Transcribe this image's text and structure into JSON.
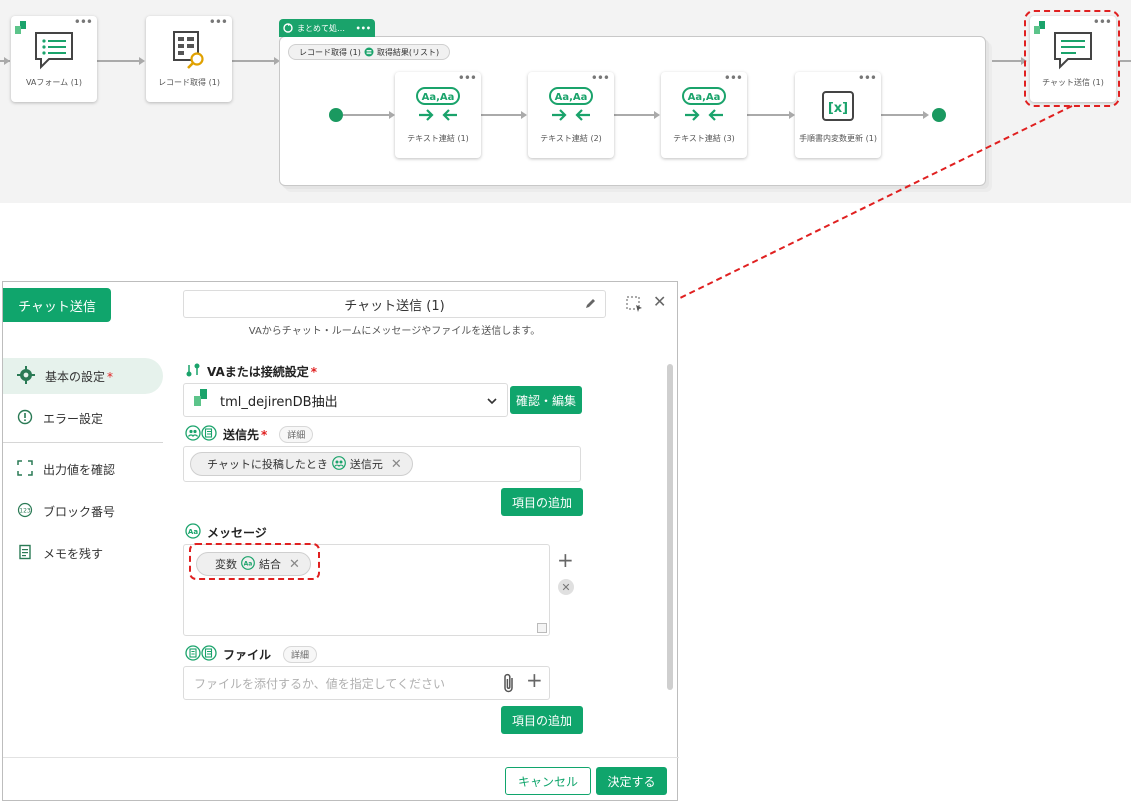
{
  "flow": {
    "nodes": [
      {
        "label": "VAフォーム (1)",
        "icon": "form-list-icon"
      },
      {
        "label": "レコード取得 (1)",
        "icon": "record-search-icon"
      },
      {
        "label": "テキスト連結 (1)",
        "icon": "text-join-icon"
      },
      {
        "label": "テキスト連結 (2)",
        "icon": "text-join-icon"
      },
      {
        "label": "テキスト連結 (3)",
        "icon": "text-join-icon"
      },
      {
        "label": "手順書内変数更新 (1)",
        "icon": "variable-icon"
      },
      {
        "label": "チャット送信 (1)",
        "icon": "chat-icon"
      }
    ],
    "group_title": "まとめて処…",
    "group_pill_source": "レコード取得 (1)",
    "group_pill_target": "取得結果(リスト)",
    "text_join_glyph": "Aa,Aa",
    "variable_glyph": "[x]"
  },
  "dialog": {
    "tag": "チャット送信",
    "title": "チャット送信 (1)",
    "subtitle": "VAからチャット・ルームにメッセージやファイルを送信します。",
    "nav": [
      {
        "label": "基本の設定",
        "icon": "gear-icon",
        "required": "*"
      },
      {
        "label": "エラー設定",
        "icon": "alert-circle-icon"
      },
      {
        "label": "出力値を確認",
        "icon": "output-frame-icon"
      },
      {
        "label": "ブロック番号",
        "icon": "number-icon"
      },
      {
        "label": "メモを残す",
        "icon": "memo-icon"
      }
    ],
    "va_section": {
      "label": "VAまたは接続設定",
      "required": "*",
      "value": "tml_dejirenDB抽出",
      "confirm_button": "確認・編集"
    },
    "dest_section": {
      "label": "送信先",
      "required": "*",
      "detail": "詳細",
      "chip_text": "チャットに投稿したとき",
      "chip_var": "送信元",
      "add_button": "項目の追加"
    },
    "msg_section": {
      "label": "メッセージ",
      "chip_text": "変数",
      "chip_var": "結合",
      "aa_glyph": "Aa"
    },
    "file_section": {
      "label": "ファイル",
      "detail": "詳細",
      "placeholder": "ファイルを添付するか、値を指定してください",
      "add_button": "項目の追加"
    },
    "footer": {
      "cancel": "キャンセル",
      "ok": "決定する"
    }
  },
  "colors": {
    "accent": "#10a56c",
    "highlight": "#e02020"
  }
}
